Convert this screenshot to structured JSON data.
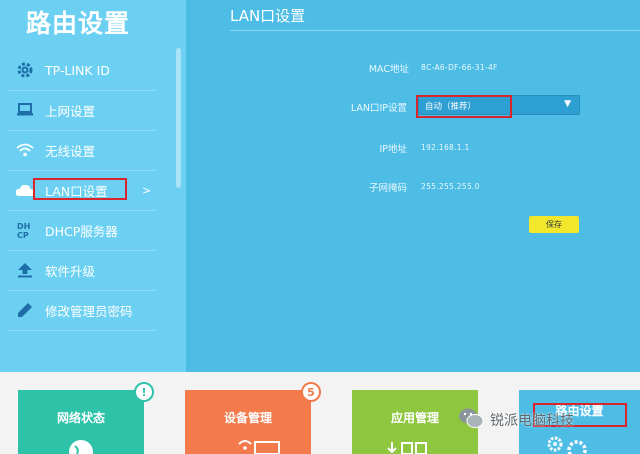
{
  "app": {
    "title": "路由设置"
  },
  "sidebar": {
    "items": [
      {
        "label": "TP-LINK ID",
        "icon": "gear-icon"
      },
      {
        "label": "上网设置",
        "icon": "laptop-icon"
      },
      {
        "label": "无线设置",
        "icon": "wifi-icon"
      },
      {
        "label": "LAN口设置",
        "icon": "cloud-icon",
        "active_arrow": ">"
      },
      {
        "label": "DHCP服务器",
        "icon": "dhcp-icon"
      },
      {
        "label": "软件升级",
        "icon": "upload-icon"
      },
      {
        "label": "修改管理员密码",
        "icon": "pencil-icon"
      }
    ]
  },
  "main": {
    "title": "LAN口设置",
    "fields": {
      "mac": {
        "label": "MAC地址",
        "value": "8C-A6-DF-66-31-4F"
      },
      "ip_mode": {
        "label": "LAN口IP设置",
        "value": "自动（推荐）"
      },
      "ip": {
        "label": "IP地址",
        "value": "192.168.1.1"
      },
      "mask": {
        "label": "子网掩码",
        "value": "255.255.255.0"
      }
    },
    "save_label": "保存"
  },
  "bottom_tiles": [
    {
      "label": "网络状态",
      "color": "#2ec3a8",
      "badge": "!"
    },
    {
      "label": "设备管理",
      "color": "#f27a4b",
      "badge": "5"
    },
    {
      "label": "应用管理",
      "color": "#8fc63f"
    },
    {
      "label": "路由设置",
      "color": "#4dbde6"
    }
  ],
  "watermark": {
    "text": "锐派电脑科技"
  },
  "colors": {
    "sidebar_bg": "#6cd0f2",
    "main_bg": "#4dbde6",
    "highlight_box": "#d8262c",
    "save_button": "#f2e72c"
  }
}
